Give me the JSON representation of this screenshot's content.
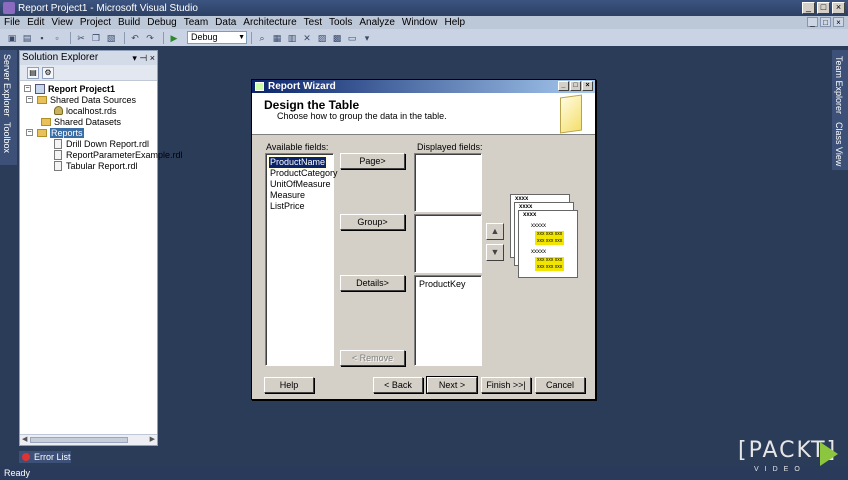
{
  "window": {
    "title": "Report Project1 - Microsoft Visual Studio"
  },
  "menu": [
    "File",
    "Edit",
    "View",
    "Project",
    "Build",
    "Debug",
    "Team",
    "Data",
    "Architecture",
    "Test",
    "Tools",
    "Analyze",
    "Window",
    "Help"
  ],
  "toolbar": {
    "configuration": "Debug"
  },
  "side_tabs": {
    "left": [
      "Server Explorer",
      "Toolbox"
    ],
    "right": [
      "Team Explorer",
      "Class View"
    ]
  },
  "solution_explorer": {
    "title": "Solution Explorer",
    "tree": {
      "project": "Report Project1",
      "shared_data_sources": "Shared Data Sources",
      "data_source": "localhost.rds",
      "shared_datasets": "Shared Datasets",
      "reports": "Reports",
      "report_1": "Drill Down Report.rdl",
      "report_2": "ReportParameterExample.rdl",
      "report_3": "Tabular Report.rdl"
    }
  },
  "error_list": "Error List",
  "status": "Ready",
  "logo": {
    "brand": "[PACKT]",
    "sub": "VIDEO"
  },
  "dialog": {
    "title": "Report Wizard",
    "heading": "Design the Table",
    "subheading": "Choose how to group the data in the table.",
    "available_label": "Available fields:",
    "displayed_label": "Displayed fields:",
    "available_fields": [
      "ProductName",
      "ProductCategory",
      "UnitOfMeasure",
      "Measure",
      "ListPrice"
    ],
    "details_fields": [
      "ProductKey"
    ],
    "buttons": {
      "page": "Page>",
      "group": "Group>",
      "details": "Details>",
      "remove": "< Remove",
      "help": "Help",
      "back": "< Back",
      "next": "Next >",
      "finish": "Finish >>|",
      "cancel": "Cancel"
    },
    "preview": {
      "header": "xxxx",
      "row": "xxxxx",
      "cell": "xxx xxx xxx"
    }
  }
}
